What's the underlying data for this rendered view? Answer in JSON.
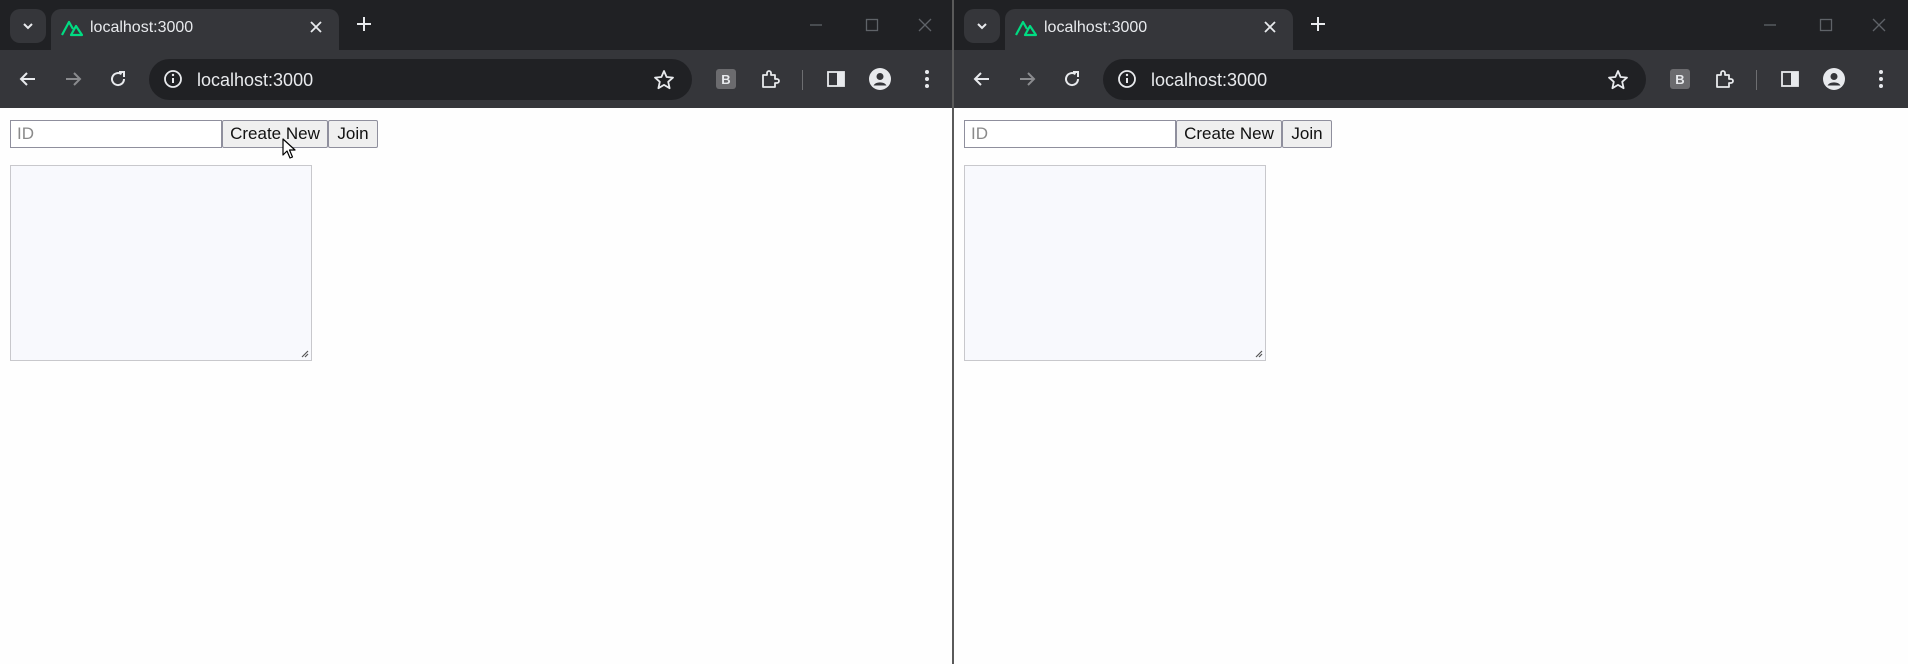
{
  "windows": [
    {
      "tab": {
        "title": "localhost:3000",
        "favicon": "nuxt-logo-icon"
      },
      "omnibox": {
        "url": "localhost:3000"
      },
      "extension_label": "B",
      "page": {
        "id_placeholder": "ID",
        "create_label": "Create New",
        "join_label": "Join"
      },
      "mouse_cursor": true
    },
    {
      "tab": {
        "title": "localhost:3000",
        "favicon": "nuxt-logo-icon"
      },
      "omnibox": {
        "url": "localhost:3000"
      },
      "extension_label": "B",
      "page": {
        "id_placeholder": "ID",
        "create_label": "Create New",
        "join_label": "Join"
      },
      "mouse_cursor": false
    }
  ],
  "colors": {
    "titlebar": "#202124",
    "toolbar": "#35363a",
    "accent_favicon": "#00dc82",
    "page_bg": "#fefefe",
    "textarea_bg": "#f8f9fd"
  }
}
